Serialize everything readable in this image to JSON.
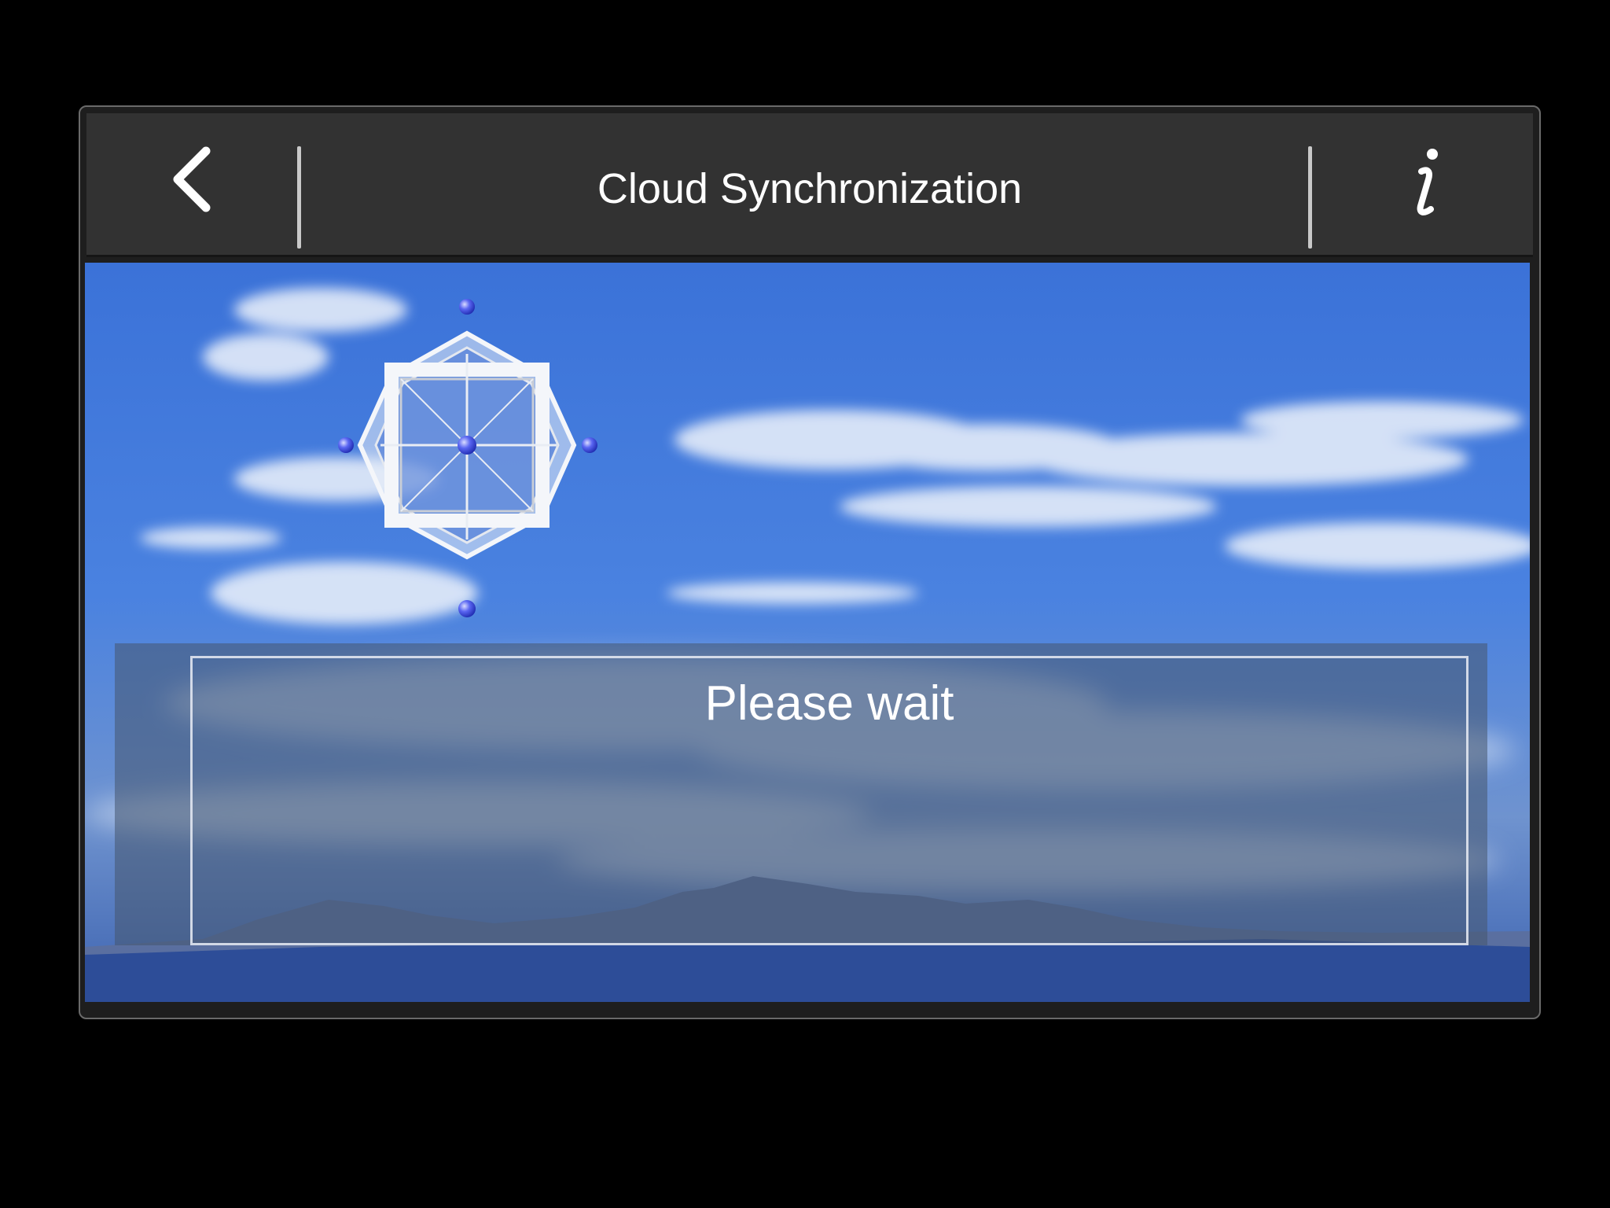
{
  "header": {
    "title": "Cloud Synchronization",
    "back_icon": "chevron-left-icon",
    "info_icon": "info-icon"
  },
  "main": {
    "status_message": "Please wait",
    "progress_icon": "sync-rotation-icon"
  },
  "colors": {
    "titlebar": "#323232",
    "sky_top": "#3a6fd4",
    "sky_bottom": "#2a4f9e",
    "accent_dot": "#3b49e8",
    "text": "#ffffff"
  }
}
